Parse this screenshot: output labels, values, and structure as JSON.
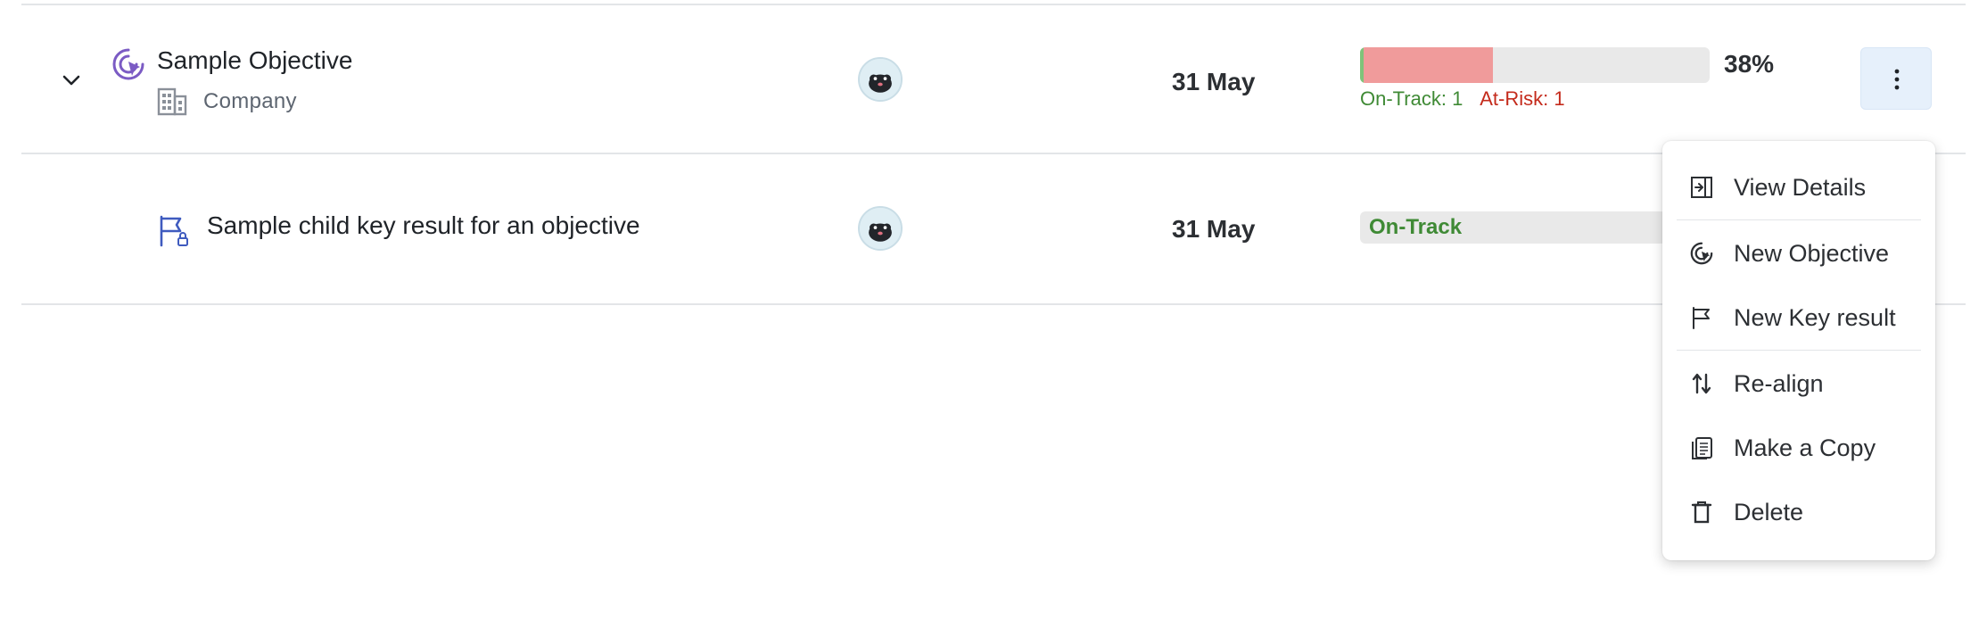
{
  "objective": {
    "title": "Sample Objective",
    "subtitle": "Company",
    "date": "31 May",
    "progress_percent": 38,
    "progress_label": "38%",
    "on_track_label": "On-Track: 1",
    "at_risk_label": "At-Risk: 1",
    "icons": {
      "expand": "chevron-down-icon",
      "type": "objective-target-icon",
      "owner_type": "building-icon",
      "more": "more-vertical-icon"
    }
  },
  "key_result": {
    "title": "Sample child key result for an objective",
    "date": "31 May",
    "status": "On-Track",
    "icons": {
      "type": "flag-lock-icon"
    }
  },
  "context_menu": {
    "items": [
      {
        "label": "View Details",
        "icon": "panel-arrow-icon"
      },
      {
        "label": "New Objective",
        "icon": "objective-target-icon"
      },
      {
        "label": "New Key result",
        "icon": "flag-icon"
      },
      {
        "label": "Re-align",
        "icon": "swap-vertical-icon"
      },
      {
        "label": "Make a Copy",
        "icon": "copy-icon"
      },
      {
        "label": "Delete",
        "icon": "trash-icon"
      }
    ]
  },
  "colors": {
    "objective_icon": "#7b5bc4",
    "kr_icon": "#3f5bbf",
    "on_track": "#3f8a35",
    "at_risk": "#c42b1c",
    "progress_fill": "#f09b9b",
    "progress_track": "#e9e9e9",
    "more_button_bg": "#e6f0fb"
  }
}
